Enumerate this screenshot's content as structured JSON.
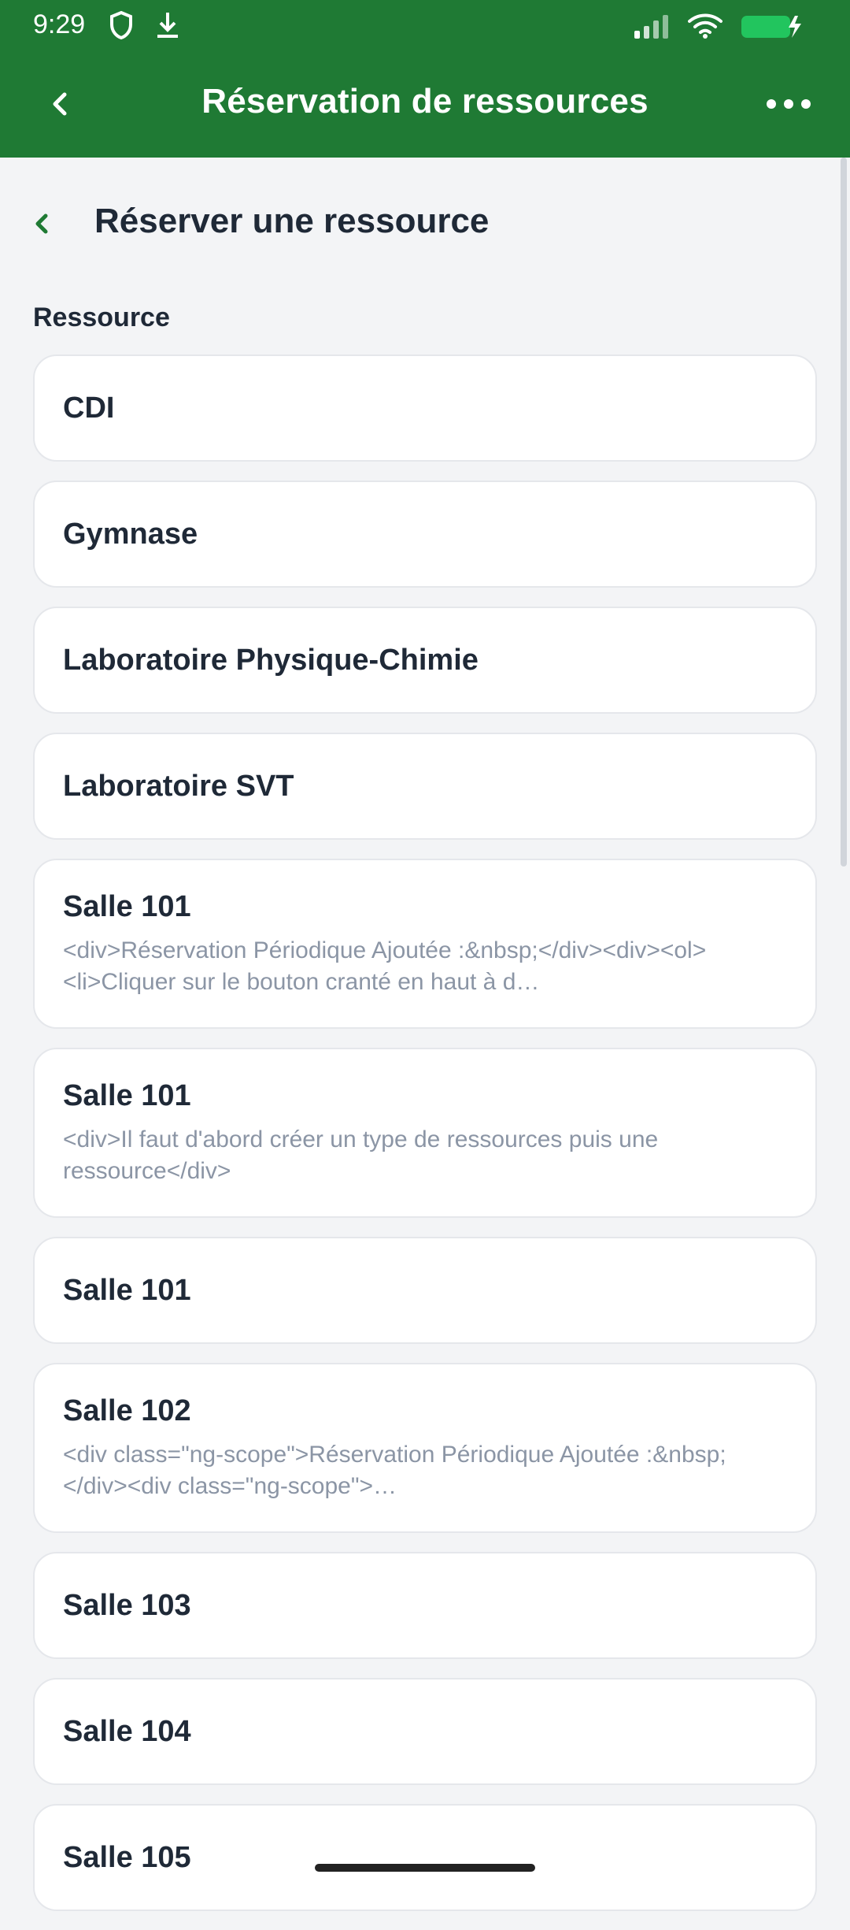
{
  "status_bar": {
    "time": "9:29",
    "icons": [
      "shield-icon",
      "download-icon",
      "signal-icon",
      "wifi-icon",
      "battery-charging-icon"
    ],
    "colors": {
      "bar": "#1f7a34",
      "battery": "#22c55e"
    }
  },
  "app_bar": {
    "title": "Réservation de ressources",
    "icons": [
      "chevron-left-icon",
      "more-horizontal-icon"
    ]
  },
  "page": {
    "title": "Réserver une ressource",
    "resource_label": "Ressource"
  },
  "resources": [
    {
      "title": "CDI",
      "desc": ""
    },
    {
      "title": "Gymnase",
      "desc": ""
    },
    {
      "title": "Laboratoire Physique-Chimie",
      "desc": ""
    },
    {
      "title": "Laboratoire SVT",
      "desc": ""
    },
    {
      "title": "Salle 101",
      "desc": "<div>Réservation Périodique Ajoutée :&nbsp;</div><div><ol><li>Cliquer sur le bouton cranté en haut à d…"
    },
    {
      "title": "Salle 101",
      "desc": "<div>Il faut d'abord créer un type de ressources puis une ressource</div>"
    },
    {
      "title": "Salle 101",
      "desc": ""
    },
    {
      "title": "Salle 102",
      "desc": "<div class=\"ng-scope\">Réservation Périodique Ajoutée :&nbsp;</div><div class=\"ng-scope\">…"
    },
    {
      "title": "Salle 103",
      "desc": ""
    },
    {
      "title": "Salle 104",
      "desc": ""
    },
    {
      "title": "Salle 105",
      "desc": ""
    }
  ]
}
